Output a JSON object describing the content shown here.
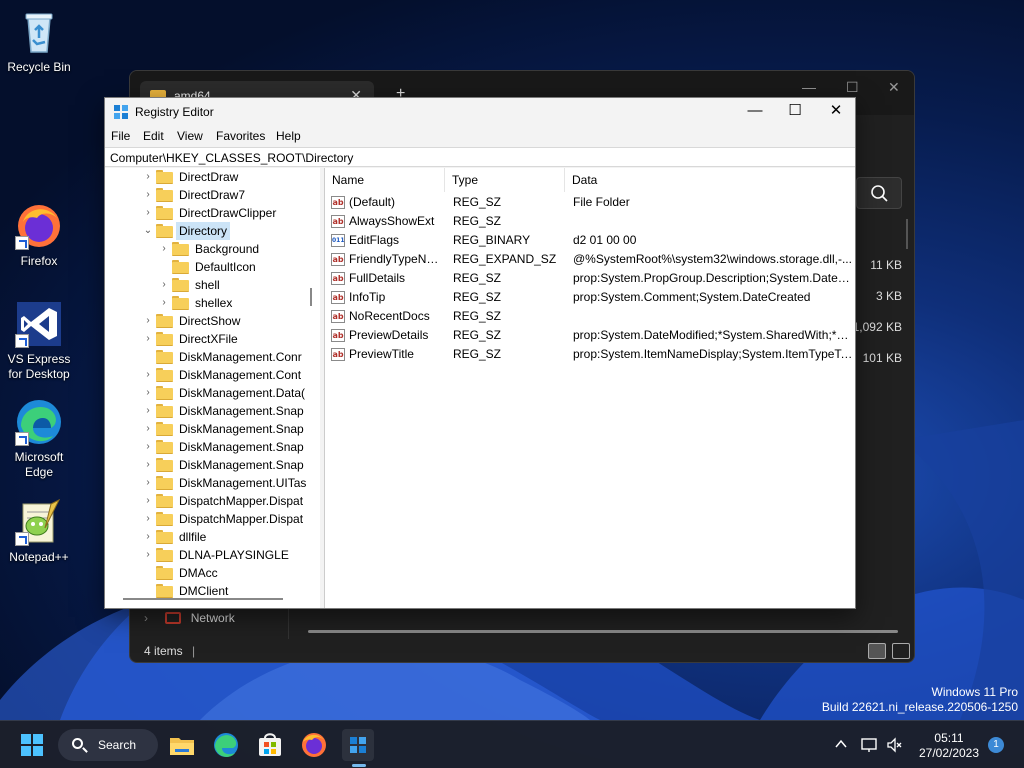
{
  "desktop": {
    "icons": [
      {
        "label": "Recycle Bin"
      },
      {
        "label": "Firefox"
      },
      {
        "label": "VS Express for Desktop"
      },
      {
        "label": "Microsoft Edge"
      },
      {
        "label": "Notepad++"
      }
    ]
  },
  "explorer": {
    "tab_title": "amd64",
    "tab_close": "✕",
    "new_tab": "+",
    "sizes": [
      "11 KB",
      "3 KB",
      "1,092 KB",
      "101 KB"
    ],
    "network_label": "Network",
    "status_text": "4 items"
  },
  "regedit": {
    "title": "Registry Editor",
    "caption_buttons": {
      "minimize": "—",
      "maximize": "☐",
      "close": "✕"
    },
    "menu": [
      "File",
      "Edit",
      "View",
      "Favorites",
      "Help"
    ],
    "address": "Computer\\HKEY_CLASSES_ROOT\\Directory",
    "tree": [
      {
        "label": "DirectDraw",
        "level": 0,
        "chevron": "›"
      },
      {
        "label": "DirectDraw7",
        "level": 0,
        "chevron": "›"
      },
      {
        "label": "DirectDrawClipper",
        "level": 0,
        "chevron": "›"
      },
      {
        "label": "Directory",
        "level": 0,
        "chevron": "⌄",
        "selected": true
      },
      {
        "label": "Background",
        "level": 1,
        "chevron": "›"
      },
      {
        "label": "DefaultIcon",
        "level": 1,
        "chevron": ""
      },
      {
        "label": "shell",
        "level": 1,
        "chevron": "›"
      },
      {
        "label": "shellex",
        "level": 1,
        "chevron": "›"
      },
      {
        "label": "DirectShow",
        "level": 0,
        "chevron": "›"
      },
      {
        "label": "DirectXFile",
        "level": 0,
        "chevron": "›"
      },
      {
        "label": "DiskManagement.Conr",
        "level": 0,
        "chevron": ""
      },
      {
        "label": "DiskManagement.Cont",
        "level": 0,
        "chevron": "›"
      },
      {
        "label": "DiskManagement.Data(",
        "level": 0,
        "chevron": "›"
      },
      {
        "label": "DiskManagement.Snap",
        "level": 0,
        "chevron": "›"
      },
      {
        "label": "DiskManagement.Snap",
        "level": 0,
        "chevron": "›"
      },
      {
        "label": "DiskManagement.Snap",
        "level": 0,
        "chevron": "›"
      },
      {
        "label": "DiskManagement.Snap",
        "level": 0,
        "chevron": "›"
      },
      {
        "label": "DiskManagement.UITas",
        "level": 0,
        "chevron": "›"
      },
      {
        "label": "DispatchMapper.Dispat",
        "level": 0,
        "chevron": "›"
      },
      {
        "label": "DispatchMapper.Dispat",
        "level": 0,
        "chevron": "›"
      },
      {
        "label": "dllfile",
        "level": 0,
        "chevron": "›"
      },
      {
        "label": "DLNA-PLAYSINGLE",
        "level": 0,
        "chevron": "›"
      },
      {
        "label": "DMAcc",
        "level": 0,
        "chevron": ""
      },
      {
        "label": "DMClient",
        "level": 0,
        "chevron": ""
      }
    ],
    "columns": [
      "Name",
      "Type",
      "Data"
    ],
    "values": [
      {
        "icon": "string",
        "name": "(Default)",
        "type": "REG_SZ",
        "data": "File Folder"
      },
      {
        "icon": "string",
        "name": "AlwaysShowExt",
        "type": "REG_SZ",
        "data": ""
      },
      {
        "icon": "binary",
        "name": "EditFlags",
        "type": "REG_BINARY",
        "data": "d2 01 00 00"
      },
      {
        "icon": "string",
        "name": "FriendlyTypeNa...",
        "type": "REG_EXPAND_SZ",
        "data": "@%SystemRoot%\\system32\\windows.storage.dll,-..."
      },
      {
        "icon": "string",
        "name": "FullDetails",
        "type": "REG_SZ",
        "data": "prop:System.PropGroup.Description;System.DateC..."
      },
      {
        "icon": "string",
        "name": "InfoTip",
        "type": "REG_SZ",
        "data": "prop:System.Comment;System.DateCreated"
      },
      {
        "icon": "string",
        "name": "NoRecentDocs",
        "type": "REG_SZ",
        "data": ""
      },
      {
        "icon": "string",
        "name": "PreviewDetails",
        "type": "REG_SZ",
        "data": "prop:System.DateModified;*System.SharedWith;*S..."
      },
      {
        "icon": "string",
        "name": "PreviewTitle",
        "type": "REG_SZ",
        "data": "prop:System.ItemNameDisplay;System.ItemTypeText"
      }
    ]
  },
  "watermark": {
    "line1": "Windows 11 Pro",
    "line2": "Build 22621.ni_release.220506-1250"
  },
  "taskbar": {
    "search_label": "Search",
    "time": "05:11",
    "date": "27/02/2023",
    "notification_count": "1",
    "apps": [
      "start-icon",
      "file-explorer-icon",
      "edge-icon",
      "store-icon",
      "firefox-icon",
      "regedit-icon"
    ],
    "colors": {
      "accent": "#76b9ed",
      "bar": "#1c202c"
    }
  }
}
